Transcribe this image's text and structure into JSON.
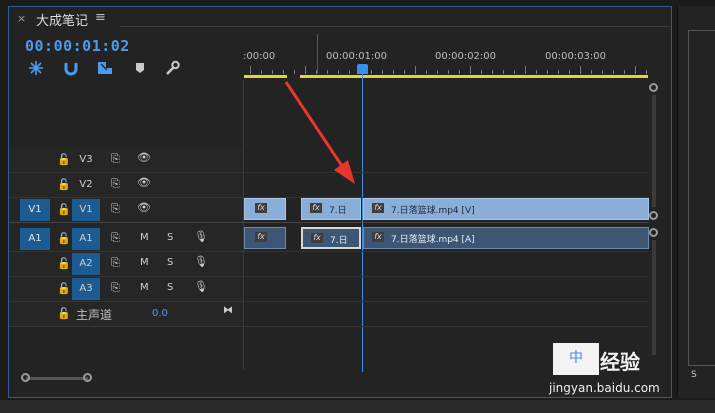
{
  "panel": {
    "close_glyph": "×",
    "title": "大成笔记",
    "menu_glyph": "≡"
  },
  "timecode": "00:00:01:02",
  "tools": [
    "snap-icon",
    "magnet-icon",
    "linked-selection-icon",
    "add-marker-icon",
    "wrench-icon"
  ],
  "ruler": {
    "labels": [
      ":00:00",
      "00:00:01:00",
      "00:00:02:00",
      "00:00:03:00"
    ]
  },
  "tracks": {
    "video": [
      {
        "target": "V3",
        "visibility": "eye"
      },
      {
        "target": "V2",
        "visibility": "eye"
      },
      {
        "source": "V1",
        "target": "V1",
        "visibility": "eye"
      }
    ],
    "audio": [
      {
        "source": "A1",
        "target": "A1",
        "m": "M",
        "s": "S"
      },
      {
        "target": "A2",
        "m": "M",
        "s": "S"
      },
      {
        "target": "A3",
        "m": "M",
        "s": "S"
      }
    ],
    "master": {
      "label": "主声道",
      "value": "0.0"
    }
  },
  "clips": {
    "video": [
      {
        "fx": "fx",
        "name": ""
      },
      {
        "fx": "fx",
        "name": "7.日"
      },
      {
        "fx": "fx",
        "name": "7.日落篮球.mp4 [V]"
      }
    ],
    "audio": [
      {
        "fx": "fx",
        "name": ""
      },
      {
        "fx": "fx",
        "name": "7.日"
      },
      {
        "fx": "fx",
        "name": "7.日落篮球.mp4 [A]"
      }
    ]
  },
  "rightpanel": {
    "s_label": "S"
  },
  "watermark": {
    "text": "jingyan.baidu.com",
    "brand": "经验",
    "char": "中"
  },
  "colors": {
    "accent": "#2d5e9a",
    "timecode": "#4a9cf0",
    "playhead": "#3b8eea",
    "video_clip": "#8aaed8",
    "audio_clip": "#3d5673",
    "work_area": "#e7d13c",
    "arrow": "#e8362d"
  }
}
